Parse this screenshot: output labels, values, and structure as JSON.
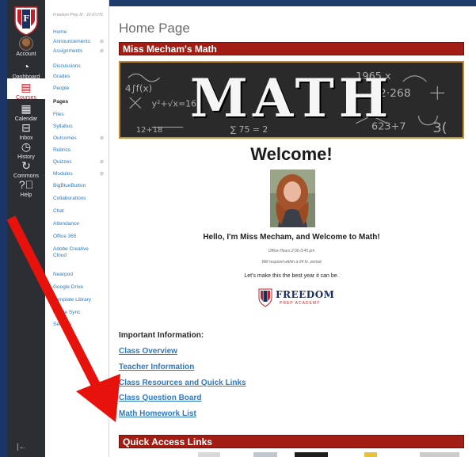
{
  "global_nav": {
    "items": [
      {
        "label": "Account",
        "icon": "avatar"
      },
      {
        "label": "Dashboard",
        "icon": "dashboard-icon"
      },
      {
        "label": "Courses",
        "icon": "book-icon"
      },
      {
        "label": "Calendar",
        "icon": "calendar-icon"
      },
      {
        "label": "Inbox",
        "icon": "inbox-icon"
      },
      {
        "label": "History",
        "icon": "clock-icon"
      },
      {
        "label": "Commons",
        "icon": "commons-icon"
      },
      {
        "label": "Help",
        "icon": "help-icon"
      }
    ],
    "active": "Courses",
    "collapse_glyph": "|←"
  },
  "course_nav": {
    "breadcrumb": "Freedom Prep M · 22-23 HS",
    "items": [
      {
        "label": "Home",
        "hidden": false
      },
      {
        "label": "Announcements",
        "hidden": true
      },
      {
        "label": "Assignments",
        "hidden": true
      },
      {
        "label": "Discussions",
        "hidden": false
      },
      {
        "label": "Grades",
        "hidden": false
      },
      {
        "label": "People",
        "hidden": false
      },
      {
        "label": "Pages",
        "hidden": false,
        "active": true
      },
      {
        "label": "Files",
        "hidden": false
      },
      {
        "label": "Syllabus",
        "hidden": false
      },
      {
        "label": "Outcomes",
        "hidden": true
      },
      {
        "label": "Rubrics",
        "hidden": false
      },
      {
        "label": "Quizzes",
        "hidden": true
      },
      {
        "label": "Modules",
        "hidden": true
      },
      {
        "label": "BigBlueButton",
        "hidden": false
      },
      {
        "label": "Collaborations",
        "hidden": false
      },
      {
        "label": "Chat",
        "hidden": false
      },
      {
        "label": "Attendance",
        "hidden": false
      },
      {
        "label": "Office 365",
        "hidden": false
      },
      {
        "label": "Adobe Creative Cloud",
        "hidden": false
      },
      {
        "label": "Nearpod",
        "hidden": false
      },
      {
        "label": "Google Drive",
        "hidden": false
      },
      {
        "label": "Template Library",
        "hidden": false
      },
      {
        "label": "Grade Sync",
        "hidden": false
      },
      {
        "label": "Settings",
        "hidden": false
      }
    ]
  },
  "main": {
    "page_title": "Home Page",
    "course_title": "Miss Mecham's Math",
    "banner_word": "MATH",
    "welcome": "Welcome!",
    "hello": "Hello, I'm Miss Mecham, and Welcome to Math!",
    "office_hours": "Office Hours 2:00-3:45 pm",
    "respond": "Will respond within a 24 hr. period",
    "best_year": "Let's make this the best year it can be.",
    "school_name": "FREEDOM",
    "school_sub": "PREP ACADEMY",
    "info_heading": "Important Information:",
    "links": [
      "Class Overview",
      "Teacher Information",
      "Class Resources and Quick Links",
      "Class Question Board",
      "Math Homework List"
    ],
    "quick_access": "Quick Access Links"
  },
  "colors": {
    "accent_red": "#a21e14",
    "link_blue": "#2d7bc2",
    "nav_dark": "#2b2f33",
    "arrow_red": "#e8120c"
  }
}
